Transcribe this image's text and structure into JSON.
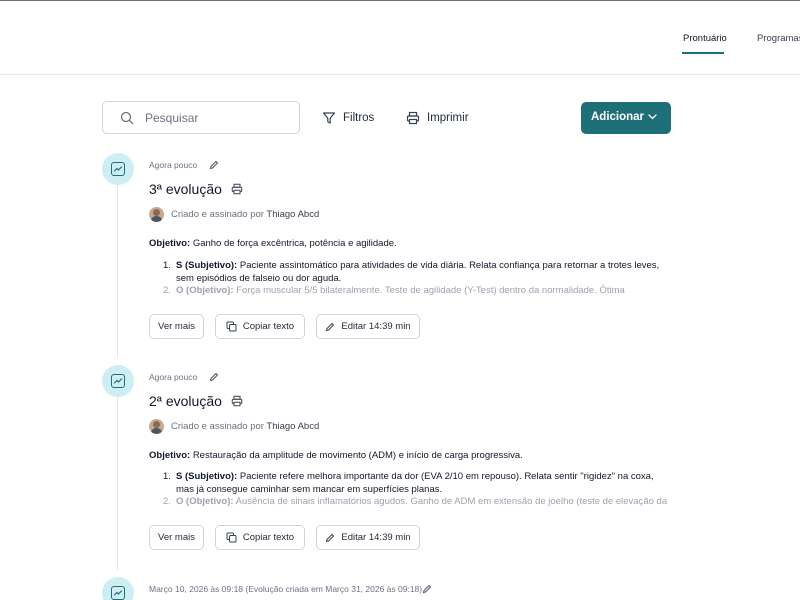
{
  "nav": {
    "tabs": [
      {
        "label": "Prontuário",
        "active": true
      },
      {
        "label": "Programas",
        "active": false
      }
    ],
    "accent": "#1f6f78"
  },
  "toolbar": {
    "search_placeholder": "Pesquisar",
    "filters_label": "Filtros",
    "print_label": "Imprimir",
    "add_label": "Adicionar"
  },
  "entries": [
    {
      "meta": "Agora pouco",
      "title": "3ª evolução",
      "created_by_prefix": "Criado e assinado por",
      "author": "Thiago Abcd",
      "objective_label": "Objetivo:",
      "objective_text": "Ganho de força excêntrica, potência e agilidade.",
      "items": [
        {
          "num": "1.",
          "label": "S (Subjetivo):",
          "text": "Paciente assintomático para atividades de vida diária. Relata confiança para retornar a trotes leves, sem episódios de falseio ou dor aguda."
        },
        {
          "num": "2.",
          "label": "O (Objetivo):",
          "text": "Força muscular 5/5 bilateralmente. Teste de agilidade (Y-Test) dentro da normalidade. Ótima"
        }
      ],
      "actions": {
        "more": "Ver mais",
        "copy": "Copiar texto",
        "edit": "Editar 14:39 min"
      }
    },
    {
      "meta": "Agora pouco",
      "title": "2ª evolução",
      "created_by_prefix": "Criado e assinado por",
      "author": "Thiago Abcd",
      "objective_label": "Objetivo:",
      "objective_text": "Restauração da amplitude de movimento (ADM) e início de carga progressiva.",
      "items": [
        {
          "num": "1.",
          "label": "S (Subjetivo):",
          "text": "Paciente refere melhora importante da dor (EVA 2/10 em repouso). Relata sentir \"rigidez\" na coxa, mas já consegue caminhar sem mancar em superfícies planas."
        },
        {
          "num": "2.",
          "label": "O (Objetivo):",
          "text": "Ausência de sinais inflamatórios agudos. Ganho de ADM em extensão de joelho (teste de elevação da"
        }
      ],
      "actions": {
        "more": "Ver mais",
        "copy": "Copiar texto",
        "edit": "Editar 14:39 min"
      }
    },
    {
      "meta": "Março 10, 2026 às 09:18 (Evolução criada em Março 31, 2026 às 09:18)"
    }
  ]
}
